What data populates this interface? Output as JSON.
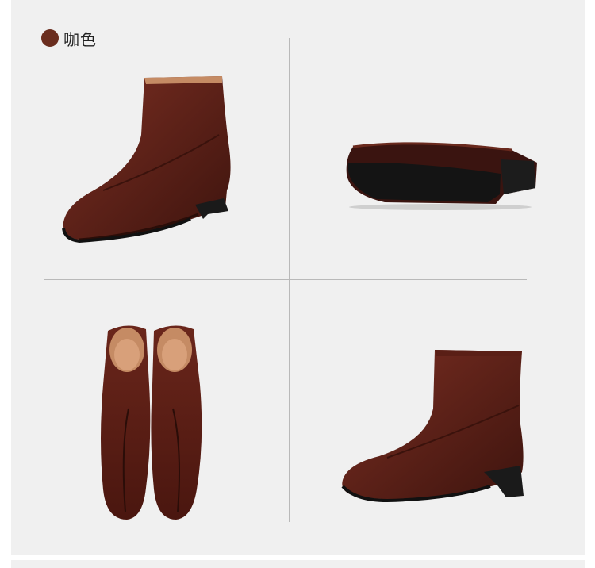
{
  "color_label": {
    "name": "咖色",
    "swatch_color": "#6a2d1e"
  },
  "palette": {
    "leather": "#5a1f16",
    "leather_light": "#8a3a2a",
    "lining": "#c58b64",
    "sole": "#1a1a1a"
  }
}
